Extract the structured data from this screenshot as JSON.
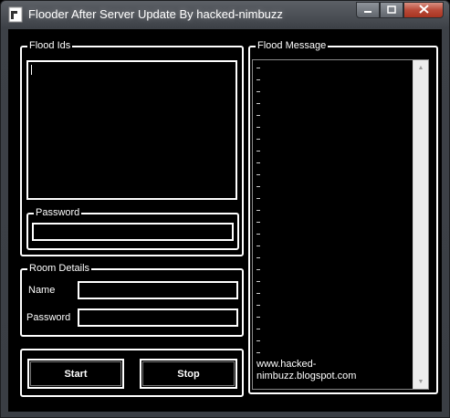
{
  "window": {
    "title": "Flooder After Server Update By hacked-nimbuzz",
    "icon": "app-icon"
  },
  "caption_buttons": {
    "minimize_icon": "minimize-icon",
    "maximize_icon": "maximize-icon",
    "close_icon": "close-icon"
  },
  "flood_ids": {
    "legend": "Flood Ids",
    "value": ""
  },
  "password_group": {
    "legend": "Password",
    "value": ""
  },
  "room_details": {
    "legend": "Room Details",
    "name_label": "Name",
    "name_value": "",
    "password_label": "Password",
    "password_value": ""
  },
  "actions": {
    "start_label": "Start",
    "stop_label": "Stop"
  },
  "flood_message": {
    "legend": "Flood Message",
    "text": "www.hacked-nimbuzz.blogspot.com"
  },
  "colors": {
    "background": "#000000",
    "border": "#ffffff",
    "text": "#ffffff",
    "titlebar": "#3d4147",
    "close_button": "#b94a38"
  }
}
